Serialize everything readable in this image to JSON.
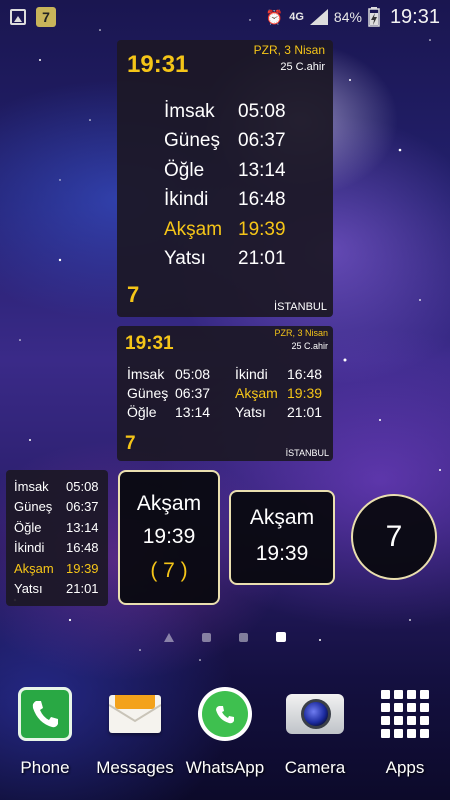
{
  "status_bar": {
    "notification_badge": "7",
    "network": "4G",
    "battery": "84%",
    "time": "19:31"
  },
  "widget_large": {
    "current_time": "19:31",
    "date": "PZR, 3 Nisan",
    "hijri": "25 C.ahir",
    "prayers": [
      {
        "name": "İmsak",
        "time": "05:08"
      },
      {
        "name": "Güneş",
        "time": "06:37"
      },
      {
        "name": "Öğle",
        "time": "13:14"
      },
      {
        "name": "İkindi",
        "time": "16:48"
      },
      {
        "name": "Akşam",
        "time": "19:39"
      },
      {
        "name": "Yatsı",
        "time": "21:01"
      }
    ],
    "countdown": "7",
    "city": "İSTANBUL"
  },
  "widget_medium": {
    "current_time": "19:31",
    "date": "PZR, 3 Nisan",
    "hijri": "25 C.ahir",
    "countdown": "7",
    "city": "İSTANBUL"
  },
  "widget_small_list": {},
  "widget_next_box": {
    "name": "Akşam",
    "time": "19:39",
    "countdown": "( 7 )"
  },
  "widget_next_compact": {
    "name": "Akşam",
    "time": "19:39"
  },
  "widget_circle": {
    "countdown": "7"
  },
  "colors": {
    "highlight": "#f5c518",
    "widget_bg": "#1c1826",
    "box_border": "#eadfaf"
  },
  "dock": [
    {
      "label": "Phone",
      "icon": "phone-icon"
    },
    {
      "label": "Messages",
      "icon": "messages-icon"
    },
    {
      "label": "WhatsApp",
      "icon": "whatsapp-icon"
    },
    {
      "label": "Camera",
      "icon": "camera-icon"
    },
    {
      "label": "Apps",
      "icon": "apps-grid-icon"
    }
  ],
  "pager": {
    "pages": 4,
    "active_page": 4
  }
}
